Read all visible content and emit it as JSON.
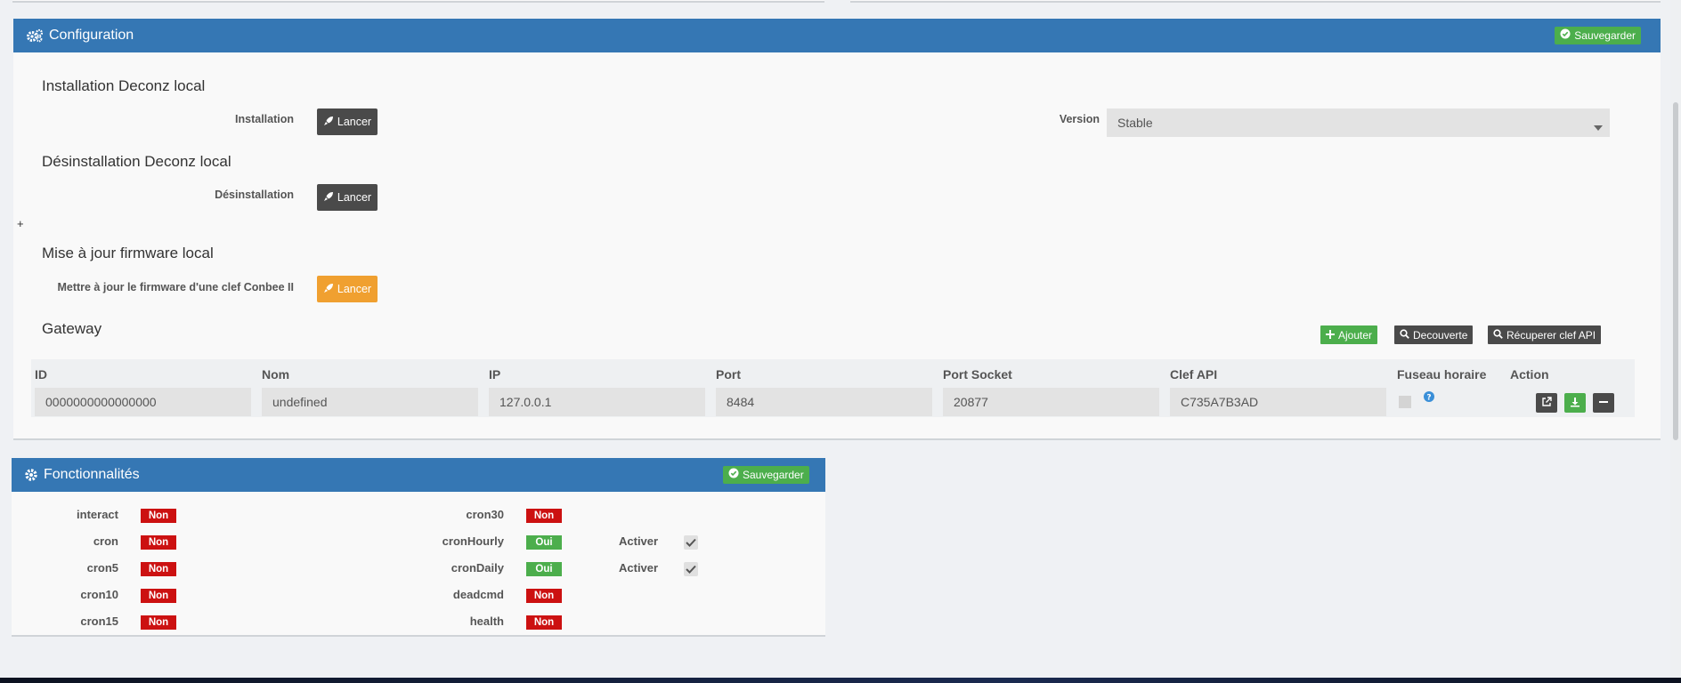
{
  "config": {
    "title": "Configuration",
    "save_label": "Sauvegarder",
    "sections": {
      "install_title": "Installation Deconz local",
      "install_label": "Installation",
      "uninstall_title": "Désinstallation Deconz local",
      "uninstall_label": "Désinstallation",
      "plus": "+",
      "firmware_title": "Mise à jour firmware local",
      "firmware_label": "Mettre à jour le firmware d'une clef Conbee II",
      "launch_label": "Lancer",
      "version_label": "Version",
      "version_value": "Stable"
    },
    "gateway": {
      "title": "Gateway",
      "add_label": "Ajouter",
      "discover_label": "Decouverte",
      "apikey_label": "Récuperer clef API",
      "headers": [
        "ID",
        "Nom",
        "IP",
        "Port",
        "Port Socket",
        "Clef API",
        "Fuseau horaire",
        "Action"
      ],
      "row": {
        "id": "0000000000000000",
        "name": "undefined",
        "ip": "127.0.0.1",
        "port": "8484",
        "port_socket": "20877",
        "api_key": "C735A7B3AD"
      }
    }
  },
  "features": {
    "title": "Fonctionnalités",
    "save_label": "Sauvegarder",
    "left": [
      {
        "name": "interact",
        "status": "Non"
      },
      {
        "name": "cron",
        "status": "Non"
      },
      {
        "name": "cron5",
        "status": "Non"
      },
      {
        "name": "cron10",
        "status": "Non"
      },
      {
        "name": "cron15",
        "status": "Non"
      }
    ],
    "right": [
      {
        "name": "cron30",
        "status": "Non"
      },
      {
        "name": "cronHourly",
        "status": "Oui",
        "activate": "Activer"
      },
      {
        "name": "cronDaily",
        "status": "Oui",
        "activate": "Activer"
      },
      {
        "name": "deadcmd",
        "status": "Non"
      },
      {
        "name": "health",
        "status": "Non"
      }
    ]
  },
  "colors": {
    "header": "#3577b4",
    "success": "#4cae4c",
    "danger": "#cc1111",
    "warning": "#f0a030",
    "dark": "#4a4a4a"
  }
}
